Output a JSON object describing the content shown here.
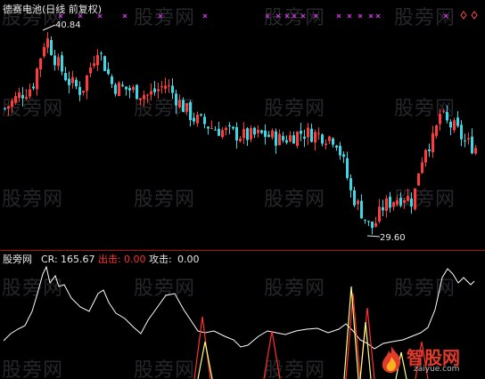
{
  "app_title": "德赛电池(日线 前复权)",
  "watermark": "股旁网",
  "price_chart": {
    "high_label": "40.84",
    "low_label": "29.60",
    "colors": {
      "up": "#ff3b3b",
      "down": "#3cd8e6",
      "signal_marker": "#d040e0",
      "diamond": "#ff4a4a"
    }
  },
  "indicator": {
    "name": "股旁网",
    "cr_label": "CR:",
    "cr_value": "165.67",
    "chuji_label": "出击:",
    "chuji_value": "0.00",
    "gongji_label": "攻击:",
    "gongji_value": "0.00",
    "colors": {
      "cr": "#ffffff",
      "chuji": "#ff3030",
      "gongji": "#ffff80"
    }
  },
  "logo": {
    "name": "智股网",
    "url": "zaiyue.com"
  },
  "chart_data": {
    "type": "candlestick",
    "title": "德赛电池(日线 前复权)",
    "price_high": 40.84,
    "price_low": 29.6,
    "indicator_series": [
      {
        "name": "CR",
        "last": 165.67
      },
      {
        "name": "出击",
        "last": 0.0
      },
      {
        "name": "攻击",
        "last": 0.0
      }
    ]
  }
}
